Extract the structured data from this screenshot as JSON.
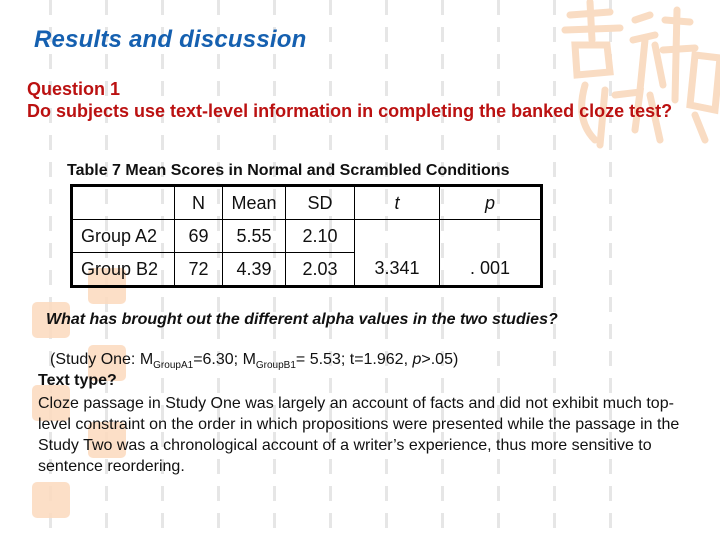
{
  "slide": {
    "title": "Results and discussion",
    "question_heading": "Question 1",
    "question_text": "Do subjects use text-level information in completing the banked cloze test?",
    "table": {
      "caption": "Table 7  Mean Scores in Normal and Scrambled Conditions",
      "headers": [
        "",
        "N",
        "Mean",
        "SD",
        "t",
        "p"
      ],
      "rows": [
        {
          "group": "Group A2",
          "n": "69",
          "mean": "5.55",
          "sd": "2.10"
        },
        {
          "group": "Group B2",
          "n": "72",
          "mean": "4.39",
          "sd": "2.03"
        }
      ],
      "t_value": "3.341",
      "p_value": ". 001"
    },
    "followup_question": "What has brought out the different alpha values in the two studies?",
    "study_one": {
      "prefix": "(Study One: M",
      "sub_a": "GroupA1",
      "mid_a": "=6.30; M",
      "sub_b": "GroupB1",
      "rest_pre": "= 5.53; t=1.962, ",
      "p_label": "p",
      "rest_post": ">.05)"
    },
    "text_type_heading": "Text type?",
    "answer": "Cloze passage in Study One was largely an account of facts and did not exhibit much top-level constraint on the order in which propositions were presented while the passage in the Study Two was a chronological account of a writer’s experience, thus more sensitive to sentence reordering."
  },
  "decoration": {
    "title_color": "#1560b0",
    "question_color": "#bb1111",
    "seal_color": "#fbd9bd"
  }
}
